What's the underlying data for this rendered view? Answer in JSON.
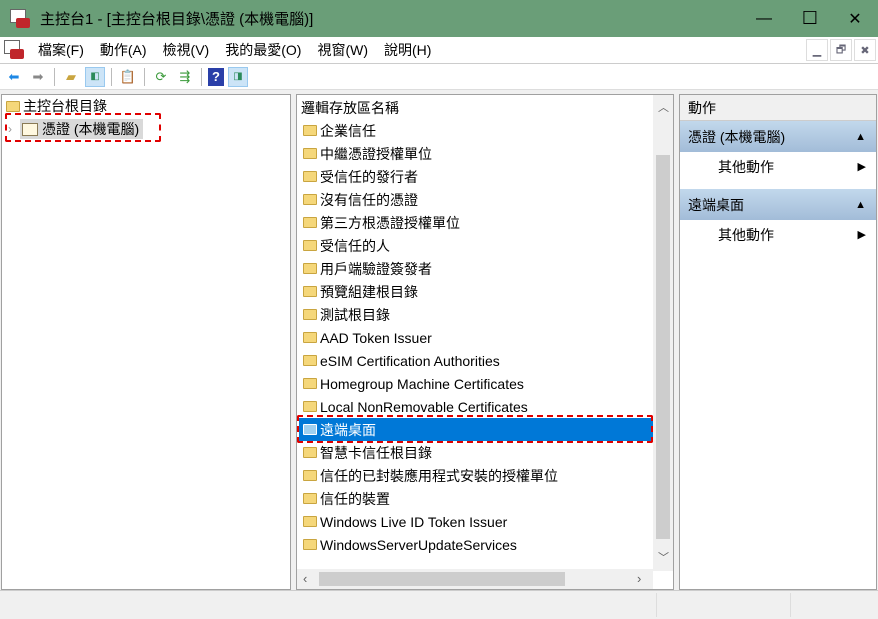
{
  "window": {
    "title": "主控台1 - [主控台根目錄\\憑證 (本機電腦)]",
    "minimize": "—",
    "maximize": "☐",
    "close": "✕"
  },
  "menu": [
    "檔案(F)",
    "動作(A)",
    "檢視(V)",
    "我的最愛(O)",
    "視窗(W)",
    "說明(H)"
  ],
  "mdi": {
    "minimize": "▁",
    "restore": "🗗",
    "close": "✖"
  },
  "tree": {
    "root": "主控台根目錄",
    "child": "憑證 (本機電腦)"
  },
  "list": {
    "header": "邏輯存放區名稱",
    "items": [
      "企業信任",
      "中繼憑證授權單位",
      "受信任的發行者",
      "沒有信任的憑證",
      "第三方根憑證授權單位",
      "受信任的人",
      "用戶端驗證簽發者",
      "預覽組建根目錄",
      "測試根目錄",
      "AAD Token Issuer",
      "eSIM Certification Authorities",
      "Homegroup Machine Certificates",
      "Local NonRemovable Certificates",
      "遠端桌面",
      "智慧卡信任根目錄",
      "信任的已封裝應用程式安裝的授權單位",
      "信任的裝置",
      "Windows Live ID Token Issuer",
      "WindowsServerUpdateServices"
    ],
    "selected_index": 13
  },
  "actions": {
    "header": "動作",
    "sections": [
      {
        "title": "憑證 (本機電腦)",
        "item": "其他動作"
      },
      {
        "title": "遠端桌面",
        "item": "其他動作"
      }
    ]
  },
  "colors": {
    "titlebar": "#6a9e78",
    "selection": "#0078d7",
    "highlight": "#e00000"
  }
}
